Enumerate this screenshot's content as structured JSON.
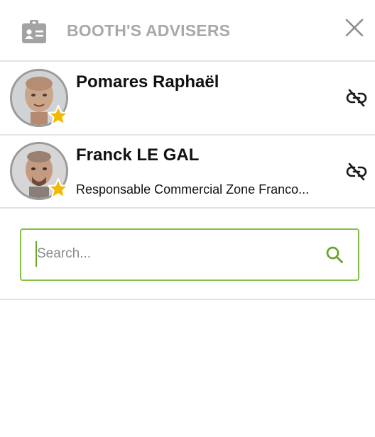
{
  "header": {
    "title": "BOOTH'S ADVISERS",
    "icon": "id-badge-icon",
    "close_icon": "close-icon"
  },
  "advisers": [
    {
      "name": "Pomares Raphaël",
      "role": "",
      "favorite": true,
      "action_icon": "unlink-icon"
    },
    {
      "name": "Franck LE GAL",
      "role": "Responsable Commercial Zone Franco...",
      "favorite": true,
      "action_icon": "unlink-icon"
    }
  ],
  "search": {
    "placeholder": "Search...",
    "value": "",
    "icon": "search-icon"
  },
  "colors": {
    "title": "#a9a9a9",
    "accent_green": "#86c048",
    "star": "#f5b800",
    "divider": "#e3e3e3"
  }
}
